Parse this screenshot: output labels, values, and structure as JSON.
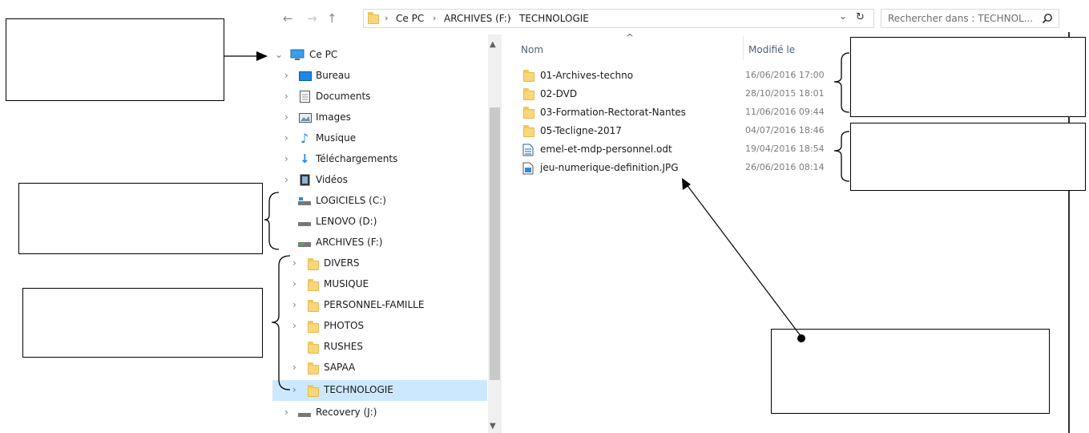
{
  "nav": {
    "back": "←",
    "forward": "→",
    "up": "↑",
    "breadcrumb": [
      "Ce PC",
      "ARCHIVES (F:)",
      "TECHNOLOGIE"
    ],
    "separator": "›",
    "dropdown": "⌄",
    "refresh": "↻"
  },
  "search": {
    "placeholder": "Rechercher dans : TECHNOL...",
    "icon": "search-icon"
  },
  "tree": {
    "root": "Ce PC",
    "items": [
      {
        "label": "Bureau",
        "icon": "desktop-icon"
      },
      {
        "label": "Documents",
        "icon": "document-icon"
      },
      {
        "label": "Images",
        "icon": "images-icon"
      },
      {
        "label": "Musique",
        "icon": "music-icon"
      },
      {
        "label": "Téléchargements",
        "icon": "download-icon"
      },
      {
        "label": "Vidéos",
        "icon": "video-icon"
      }
    ],
    "drives": [
      "LOGICIELS (C:)",
      "LENOVO (D:)",
      "ARCHIVES (F:)"
    ],
    "folders": [
      "DIVERS",
      "MUSIQUE",
      "PERSONNEL-FAMILLE",
      "PHOTOS",
      "RUSHES",
      "SAPAA",
      "TECHNOLOGIE"
    ],
    "selected": "TECHNOLOGIE",
    "recovery": "Recovery (J:)"
  },
  "list": {
    "col_name": "Nom",
    "col_modified": "Modifié le",
    "files": [
      {
        "name": "01-Archives-techno",
        "date": "16/06/2016 17:00",
        "kind": "folder"
      },
      {
        "name": "02-DVD",
        "date": "28/10/2015 18:01",
        "kind": "folder"
      },
      {
        "name": "03-Formation-Rectorat-Nantes",
        "date": "11/06/2016 09:44",
        "kind": "folder"
      },
      {
        "name": "05-Tecligne-2017",
        "date": "04/07/2016 18:46",
        "kind": "folder"
      },
      {
        "name": "emel-et-mdp-personnel.odt",
        "date": "19/04/2016 18:54",
        "kind": "odt"
      },
      {
        "name": "jeu-numerique-definition.JPG",
        "date": "26/06/2016 08:14",
        "kind": "jpg"
      }
    ]
  },
  "colors": {
    "selection": "#cce8ff",
    "folder": "#f8d77a",
    "accent": "#1e7fd8"
  }
}
